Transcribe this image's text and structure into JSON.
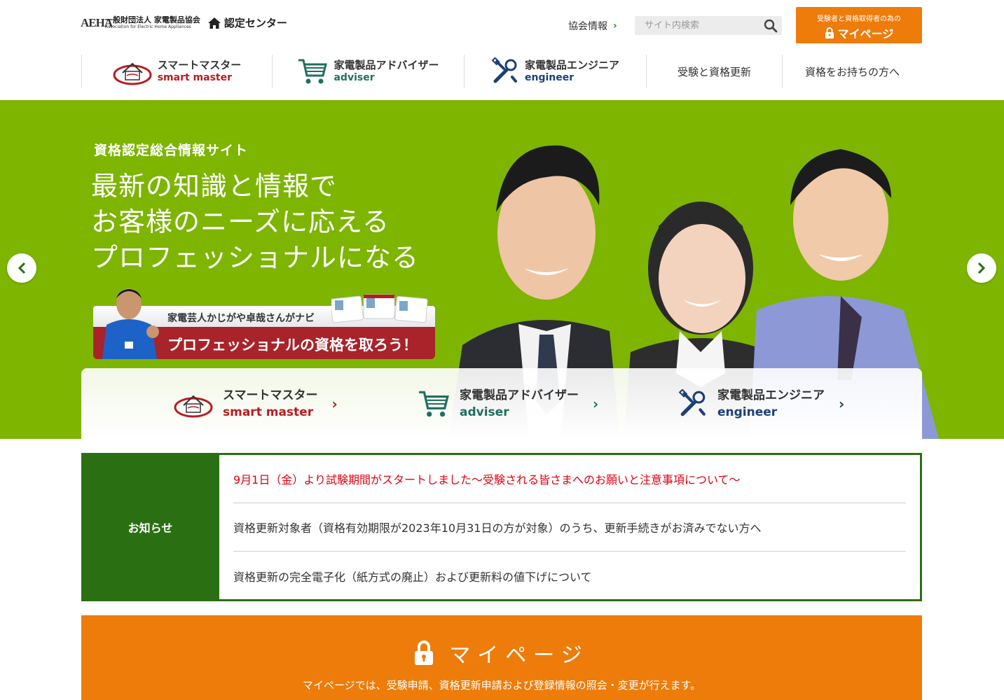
{
  "header": {
    "logo_mark": "AEHA",
    "logo_jp": "一般財団法人 家電製品協会",
    "logo_en": "Association for Electric Home Appliances",
    "center_label": "認定センター",
    "assoc_link": "協会情報",
    "search_placeholder": "サイト内検索",
    "mypage_sub": "受験者と資格取得者の為の",
    "mypage_main": "マイページ"
  },
  "nav": {
    "items": [
      {
        "jp": "スマートマスター",
        "en": "smart master"
      },
      {
        "jp": "家電製品アドバイザー",
        "en": "adviser"
      },
      {
        "jp": "家電製品エンジニア",
        "en": "engineer"
      },
      {
        "label": "受験と資格更新"
      },
      {
        "label": "資格をお持ちの方へ"
      }
    ]
  },
  "hero": {
    "kicker": "資格認定総合情報サイト",
    "headline": [
      "最新の知識と情報で",
      "お客様のニーズに応える",
      "プロフェッショナルになる"
    ],
    "navi_top": "家電芸人かじがや卓哉さんがナビ",
    "navi_bottom": "プロフェッショナルの資格を取ろう！"
  },
  "quick": {
    "items": [
      {
        "jp": "スマートマスター",
        "en": "smart master"
      },
      {
        "jp": "家電製品アドバイザー",
        "en": "adviser"
      },
      {
        "jp": "家電製品エンジニア",
        "en": "engineer"
      }
    ]
  },
  "news": {
    "label": "お知らせ",
    "items": [
      "9月1日（金）より試験期間がスタートしました〜受験される皆さまへのお願いと注意事項について〜",
      "資格更新対象者（資格有効期限が2023年10月31日の方が対象）のうち、更新手続きがお済みでない方へ",
      "資格更新の完全電子化（紙方式の廃止）および更新料の値下げについて"
    ]
  },
  "mypage": {
    "title": "マイページ",
    "desc": "マイページでは、受験申請、資格更新申請および登録情報の照会・変更が行えます。"
  },
  "colors": {
    "hero_green": "#7db500",
    "news_green": "#2b6f13",
    "orange": "#ee7c0a",
    "smart_red": "#b81c22",
    "adviser_teal": "#1f6f60",
    "engineer_navy": "#1d3f78",
    "alert_red": "#e2000f"
  }
}
